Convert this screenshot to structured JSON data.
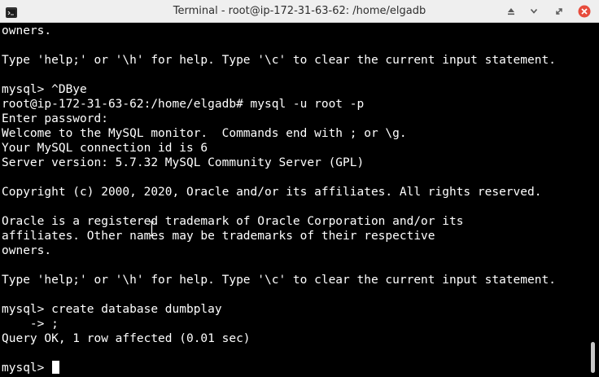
{
  "window": {
    "title": "Terminal - root@ip-172-31-63-62: /home/elgadb",
    "icons": {
      "app": "terminal-icon",
      "keep_above": "keep-above-icon",
      "minimize": "minimize-icon",
      "maximize": "maximize-icon",
      "close": "close-icon"
    },
    "colors": {
      "titlebar": "#efefef",
      "close": "#e74c3c",
      "terminal_bg": "#000000",
      "terminal_fg": "#ffffff"
    }
  },
  "terminal": {
    "lines": [
      "owners.",
      "",
      "Type 'help;' or '\\h' for help. Type '\\c' to clear the current input statement.",
      "",
      "mysql> ^DBye",
      "root@ip-172-31-63-62:/home/elgadb# mysql -u root -p",
      "Enter password:",
      "Welcome to the MySQL monitor.  Commands end with ; or \\g.",
      "Your MySQL connection id is 6",
      "Server version: 5.7.32 MySQL Community Server (GPL)",
      "",
      "Copyright (c) 2000, 2020, Oracle and/or its affiliates. All rights reserved.",
      "",
      "Oracle is a registered trademark of Oracle Corporation and/or its",
      "affiliates. Other names may be trademarks of their respective",
      "owners.",
      "",
      "Type 'help;' or '\\h' for help. Type '\\c' to clear the current input statement.",
      "",
      "mysql> create database dumbplay",
      "    -> ;",
      "Query OK, 1 row affected (0.01 sec)",
      ""
    ],
    "prompt": "mysql> "
  }
}
